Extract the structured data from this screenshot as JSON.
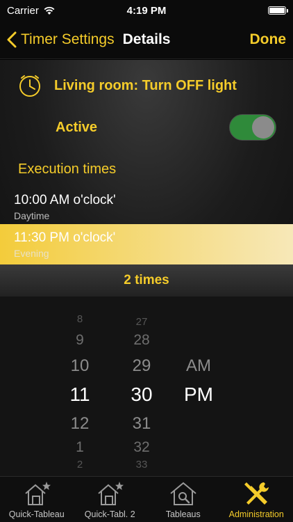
{
  "status_bar": {
    "carrier": "Carrier",
    "time": "4:19 PM"
  },
  "nav": {
    "back_label": "Timer Settings",
    "title": "Details",
    "done_label": "Done"
  },
  "timer": {
    "name": "Living room: Turn OFF light",
    "active_label": "Active",
    "active": true
  },
  "executions": {
    "header": "Execution times",
    "items": [
      {
        "time": "10:00 AM o'clock'",
        "label": "Daytime"
      },
      {
        "time": "11:30 PM o'clock'",
        "label": "Evening"
      }
    ],
    "count_label": "2 times"
  },
  "picker": {
    "hours": [
      "8",
      "9",
      "10",
      "11",
      "12",
      "1",
      "2"
    ],
    "minutes": [
      "27",
      "28",
      "29",
      "30",
      "31",
      "32",
      "33"
    ],
    "periods": [
      "AM",
      "PM"
    ],
    "selected": {
      "hour": "11",
      "minute": "30",
      "period": "PM"
    }
  },
  "tabs": [
    {
      "label": "Quick-Tableau"
    },
    {
      "label": "Quick-Tabl. 2"
    },
    {
      "label": "Tableaus"
    },
    {
      "label": "Administration"
    }
  ],
  "colors": {
    "accent": "#f5cc2a",
    "toggle_on": "#2f8a3a"
  }
}
